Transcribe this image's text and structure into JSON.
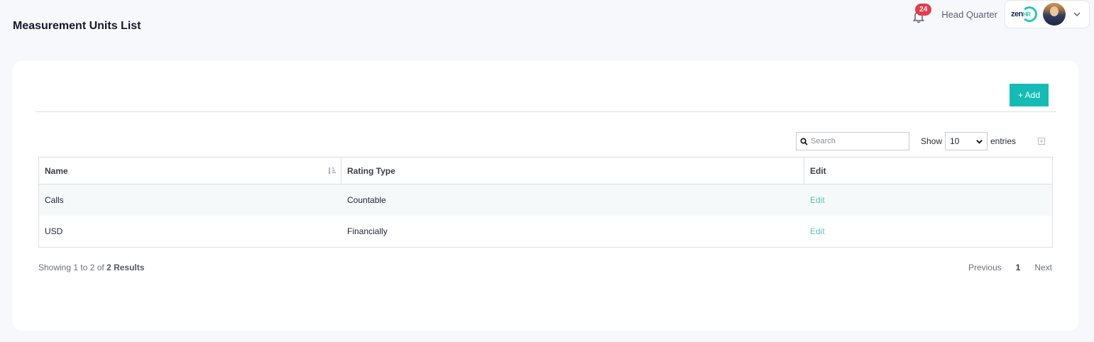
{
  "page": {
    "title": "Measurement Units List"
  },
  "header": {
    "notifications_count": "24",
    "company": "Head Quarter",
    "logo": {
      "main": "zen",
      "accent": "HR"
    }
  },
  "toolbar": {
    "add_label": "+ Add"
  },
  "controls": {
    "search_placeholder": "Search",
    "show_label": "Show",
    "page_size": "10",
    "entries_label": "entries"
  },
  "table": {
    "columns": [
      "Name",
      "Rating Type",
      "Edit"
    ],
    "rows": [
      {
        "name": "Calls",
        "rating_type": "Countable",
        "edit": "Edit"
      },
      {
        "name": "USD",
        "rating_type": "Financially",
        "edit": "Edit"
      }
    ]
  },
  "footer": {
    "showing_prefix": "Showing 1 to 2 of",
    "showing_total": "2 Results",
    "prev": "Previous",
    "current_page": "1",
    "next": "Next"
  },
  "colors": {
    "accent": "#15bcb5",
    "badge": "#e33d4c",
    "link": "#5cc5b0"
  },
  "icons": [
    "bell-icon",
    "chevron-down-icon",
    "search-icon",
    "sort-icon",
    "export-icon"
  ]
}
